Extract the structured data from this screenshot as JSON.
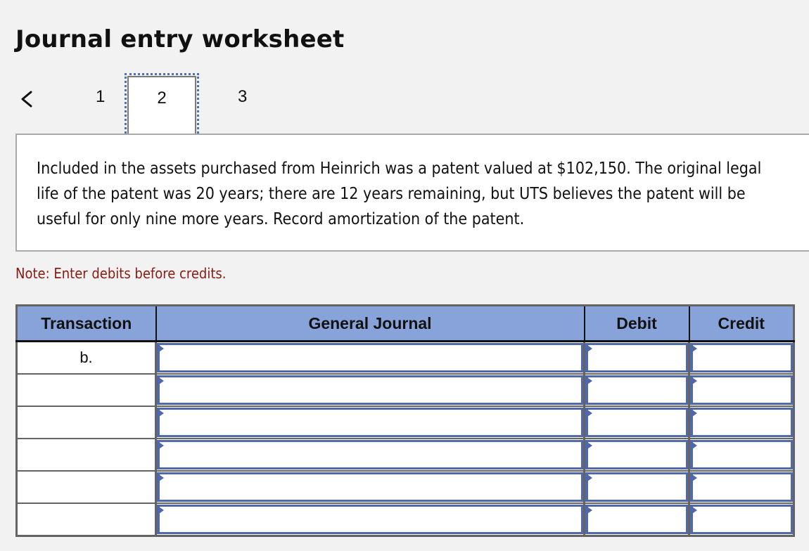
{
  "header": {
    "title": "Journal entry worksheet"
  },
  "nav": {
    "prev_icon": "chevron-left-icon",
    "pages": [
      "1",
      "2",
      "3"
    ],
    "active_page": "2"
  },
  "question": {
    "text": "Included in the assets purchased from Heinrich was a patent valued at $102,150. The original legal life of the patent was 20 years; there are 12 years remaining, but UTS believes the patent will be useful for only nine more years. Record amortization of the patent."
  },
  "note": "Note: Enter debits before credits.",
  "table": {
    "headers": {
      "transaction": "Transaction",
      "general_journal": "General Journal",
      "debit": "Debit",
      "credit": "Credit"
    },
    "rows": [
      {
        "transaction": "b.",
        "account": "",
        "debit": "",
        "credit": ""
      },
      {
        "transaction": "",
        "account": "",
        "debit": "",
        "credit": ""
      },
      {
        "transaction": "",
        "account": "",
        "debit": "",
        "credit": ""
      },
      {
        "transaction": "",
        "account": "",
        "debit": "",
        "credit": ""
      },
      {
        "transaction": "",
        "account": "",
        "debit": "",
        "credit": ""
      },
      {
        "transaction": "",
        "account": "",
        "debit": "",
        "credit": ""
      }
    ],
    "colors": {
      "header_bg": "#88a3da",
      "input_border": "#5169a8",
      "note_text": "#8b1a10"
    }
  }
}
